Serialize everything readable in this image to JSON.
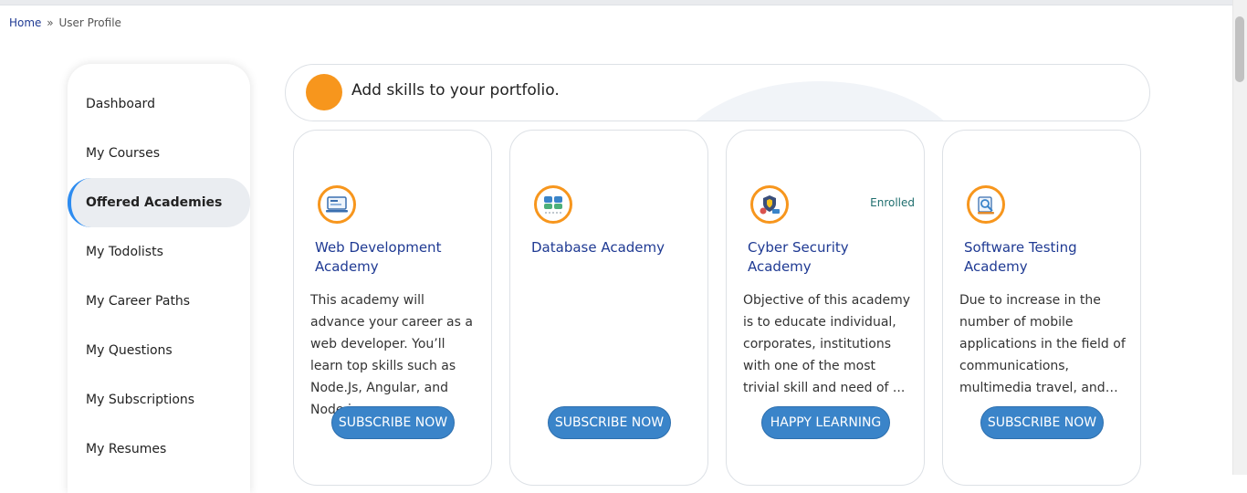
{
  "breadcrumb": {
    "home": "Home",
    "separator": "»",
    "current": "User Profile"
  },
  "sidebar": {
    "items": [
      {
        "label": "Dashboard",
        "active": false
      },
      {
        "label": "My Courses",
        "active": false
      },
      {
        "label": "Offered Academies",
        "active": true
      },
      {
        "label": "My Todolists",
        "active": false
      },
      {
        "label": "My Career Paths",
        "active": false
      },
      {
        "label": "My Questions",
        "active": false
      },
      {
        "label": "My Subscriptions",
        "active": false
      },
      {
        "label": "My Resumes",
        "active": false
      }
    ]
  },
  "banner": {
    "text": "Add skills to your portfolio."
  },
  "cards": [
    {
      "title": "Web Development Academy",
      "description": "This academy will advance your career as a web developer. You’ll learn top skills such as Node.Js, Angular, and Node.js ...",
      "status": "",
      "button": "SUBSCRIBE NOW",
      "icon": "web-development-icon"
    },
    {
      "title": "Database Academy",
      "description": "",
      "status": "",
      "button": "SUBSCRIBE NOW",
      "icon": "database-icon"
    },
    {
      "title": "Cyber Security Academy",
      "description": "Objective of this academy is to educate individual, corporates, institutions with one of the most trivial skill and need of ...",
      "status": "Enrolled",
      "button": "HAPPY LEARNING",
      "icon": "cyber-security-icon"
    },
    {
      "title": "Software Testing Academy",
      "description": "Due to increase in the number of mobile applications in the field of communications, multimedia travel, and…",
      "status": "",
      "button": "SUBSCRIBE NOW",
      "icon": "software-testing-icon"
    }
  ],
  "colors": {
    "accent": "#f7961d",
    "button": "#3a84c9",
    "title": "#1f3a93",
    "active_border": "#2d8cf0"
  }
}
